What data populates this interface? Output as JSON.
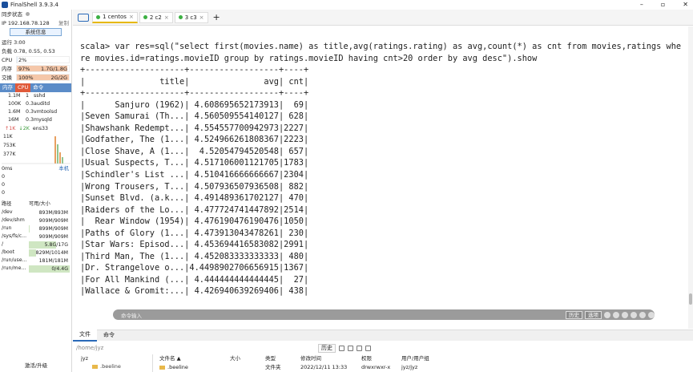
{
  "app": {
    "title": "FinalShell 3.9.3.4"
  },
  "sidebar": {
    "sync_status": "同步状态",
    "ip": "IP 192.168.78.128",
    "copy": "复制",
    "sys_info": "系统信息",
    "uptime": "运行 3:00",
    "load": "负载 0.78, 0.55, 0.53",
    "cpu": {
      "label": "CPU",
      "text": "2%",
      "value": 2,
      "color": "#dbe9f7"
    },
    "mem": {
      "label": "内存",
      "pct": "97%",
      "text": "1.7G/1.8G",
      "value": 97,
      "color": "#f5c7a9"
    },
    "swap": {
      "label": "交换",
      "pct": "100%",
      "text": "2G/2G",
      "value": 100,
      "color": "#f5c7a9"
    },
    "proc_tabs": [
      "内存",
      "CPU",
      "命令"
    ],
    "processes": [
      {
        "mem": "1.1M",
        "cpu": "1",
        "cmd": "sshd"
      },
      {
        "mem": "100K",
        "cpu": "0.3",
        "cmd": "auditd"
      },
      {
        "mem": "1.6M",
        "cpu": "0.3",
        "cmd": "vmtoolsd"
      },
      {
        "mem": "16M",
        "cpu": "0.3",
        "cmd": "mysqld"
      }
    ],
    "net": {
      "up": "↑1K",
      "down": "↓2K",
      "iface": "ens33"
    },
    "net_axis": [
      "11K",
      "753K",
      "377K"
    ],
    "latency": {
      "label": "0ms",
      "link": "本机",
      "values": [
        "0",
        "0",
        "0"
      ]
    },
    "disk_header": {
      "path": "路径",
      "size": "可用/大小"
    },
    "disks": [
      {
        "path": "/dev",
        "size": "893M/893M",
        "used": 0
      },
      {
        "path": "/dev/shm",
        "size": "909M/909M",
        "used": 0
      },
      {
        "path": "/run",
        "size": "899M/909M",
        "used": 1
      },
      {
        "path": "/sys/fs/c...",
        "size": "909M/909M",
        "used": 0
      },
      {
        "path": "/",
        "size": "5.8G/17G",
        "used": 66
      },
      {
        "path": "/boot",
        "size": "829M/1014M",
        "used": 18
      },
      {
        "path": "/run/use...",
        "size": "181M/181M",
        "used": 0
      },
      {
        "path": "/run/me...",
        "size": "0/4.4G",
        "used": 100
      }
    ],
    "upgrade": "激活/升级"
  },
  "tabs": [
    {
      "label": "1 centos",
      "active": true
    },
    {
      "label": "2 c2",
      "active": false
    },
    {
      "label": "3 c3",
      "active": false
    }
  ],
  "terminal": {
    "lines": [
      "scala> var res=sql(\"select first(movies.name) as title,avg(ratings.rating) as avg,count(*) as cnt from movies,ratings whe",
      "re movies.id=ratings.movieID group by ratings.movieID having cnt>20 order by avg desc\").show",
      "+--------------------+------------------+----+",
      "|               title|               avg| cnt|",
      "+--------------------+------------------+----+",
      "|      Sanjuro (1962)| 4.608695652173913|  69|",
      "|Seven Samurai (Th...| 4.560509554140127| 628|",
      "|Shawshank Redempt...| 4.554557700942973|2227|",
      "|Godfather, The (1...| 4.524966261808367|2223|",
      "|Close Shave, A (1...|  4.52054794520548| 657|",
      "|Usual Suspects, T...| 4.517106001121705|1783|",
      "|Schindler's List ...| 4.510416666666667|2304|",
      "|Wrong Trousers, T...| 4.507936507936508| 882|",
      "|Sunset Blvd. (a.k...| 4.491489361702127| 470|",
      "|Raiders of the Lo...| 4.477724741447892|2514|",
      "|  Rear Window (1954)| 4.476190476190476|1050|",
      "|Paths of Glory (1...| 4.473913043478261| 230|",
      "|Star Wars: Episod...| 4.453694416583082|2991|",
      "|Third Man, The (1...| 4.452083333333333| 480|",
      "|Dr. Strangelove o...|4.4498902706656915|1367|",
      "|For All Mankind (...| 4.444444444444445|  27|",
      "|Wallace & Gromit:...| 4.426940639269406| 438|"
    ]
  },
  "cmdbar": {
    "placeholder": "命令输入",
    "history": "历史",
    "options": "选项"
  },
  "bottom_tabs": [
    "文件",
    "命令"
  ],
  "filebar": {
    "path": "/home/jyz",
    "history": "历史"
  },
  "tree": {
    "root": "jyz",
    "child": ".beeline"
  },
  "file_columns": [
    "文件名 ▲",
    "大小",
    "类型",
    "修改时间",
    "权限",
    "用户/用户组"
  ],
  "files": [
    {
      "name": ".beeline",
      "size": "",
      "type": "文件夹",
      "mtime": "2022/12/11 13:33",
      "perm": "drwxrwxr-x",
      "owner": "jyz/jyz"
    }
  ]
}
